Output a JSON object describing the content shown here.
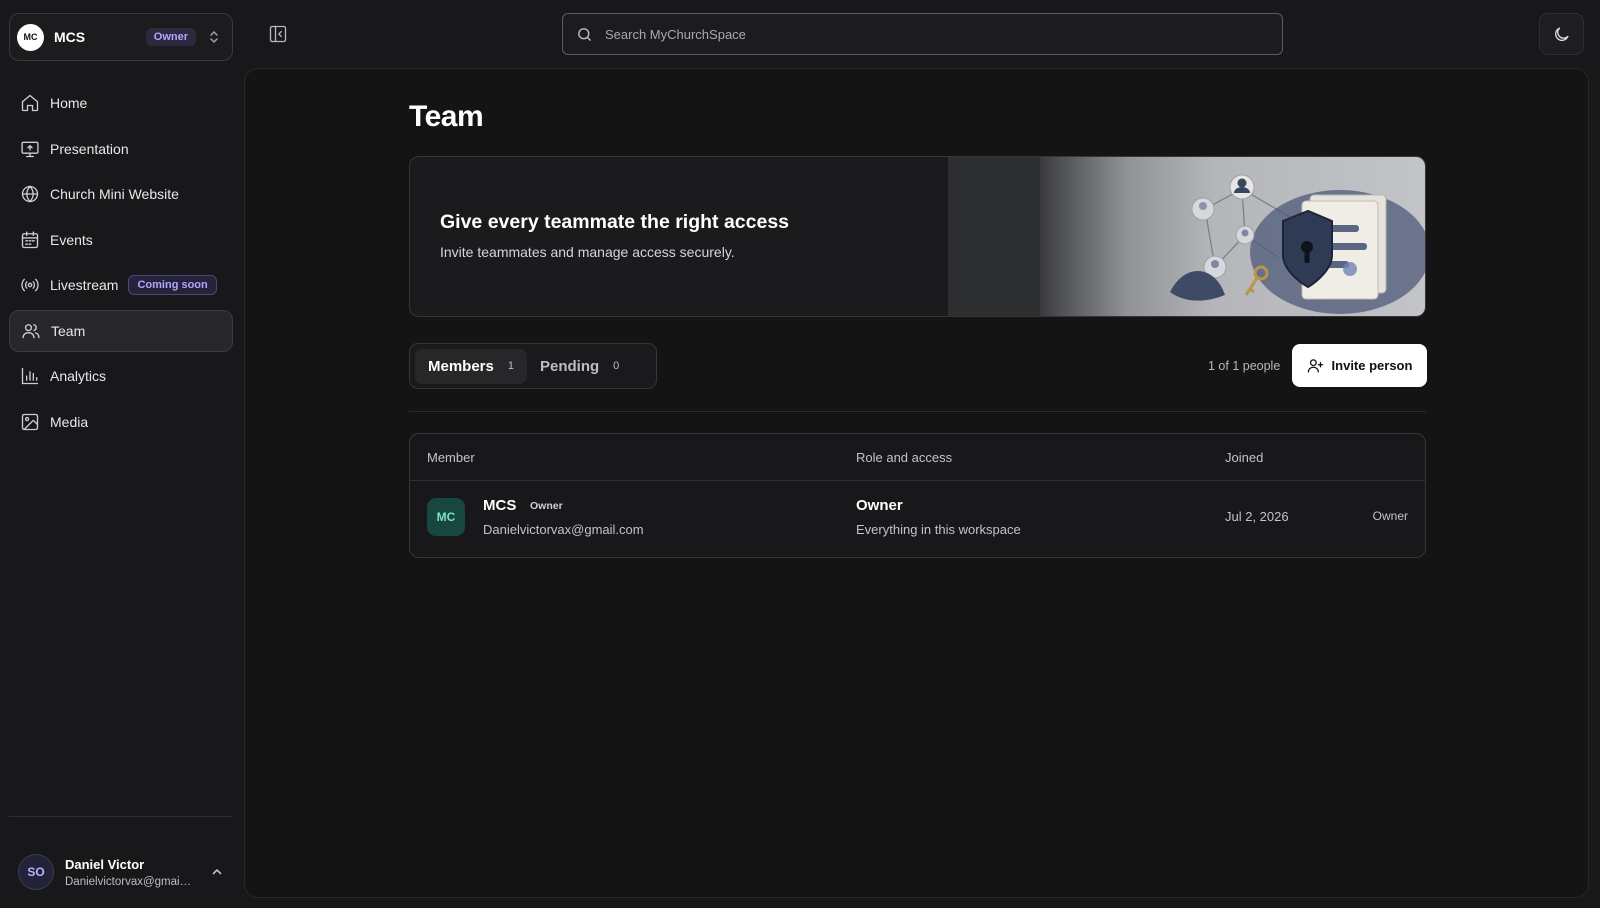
{
  "workspace": {
    "avatar": "MC",
    "name": "MCS",
    "role_badge": "Owner"
  },
  "nav": {
    "items": [
      {
        "label": "Home",
        "icon": "home-icon"
      },
      {
        "label": "Presentation",
        "icon": "presentation-icon"
      },
      {
        "label": "Church Mini Website",
        "icon": "globe-icon"
      },
      {
        "label": "Events",
        "icon": "calendar-icon"
      },
      {
        "label": "Livestream",
        "icon": "broadcast-icon",
        "badge": "Coming soon"
      },
      {
        "label": "Team",
        "icon": "users-icon",
        "active": true
      },
      {
        "label": "Analytics",
        "icon": "bar-chart-icon"
      },
      {
        "label": "Media",
        "icon": "image-icon"
      }
    ]
  },
  "user": {
    "avatar": "SO",
    "name": "Daniel Victor",
    "email": "Danielvictorvax@gmail.com"
  },
  "search": {
    "placeholder": "Search MyChurchSpace"
  },
  "page": {
    "title": "Team",
    "hero": {
      "title": "Give every teammate the right access",
      "subtitle": "Invite teammates and manage access securely."
    },
    "tabs": [
      {
        "label": "Members",
        "count": "1",
        "active": true
      },
      {
        "label": "Pending",
        "count": "0"
      }
    ],
    "people_count": "1 of 1 people",
    "invite_label": "Invite person"
  },
  "table": {
    "headers": {
      "member": "Member",
      "role": "Role and access",
      "joined": "Joined"
    },
    "rows": [
      {
        "avatar": "MC",
        "name": "MCS",
        "badge": "Owner",
        "email": "Danielvictorvax@gmail.com",
        "role": "Owner",
        "role_desc": "Everything in this workspace",
        "joined": "Jul 2, 2026",
        "access": "Owner"
      }
    ]
  },
  "colors": {
    "accent": "#b3a6ff",
    "background": "#18181a",
    "member_avatar_bg": "#17473f"
  }
}
